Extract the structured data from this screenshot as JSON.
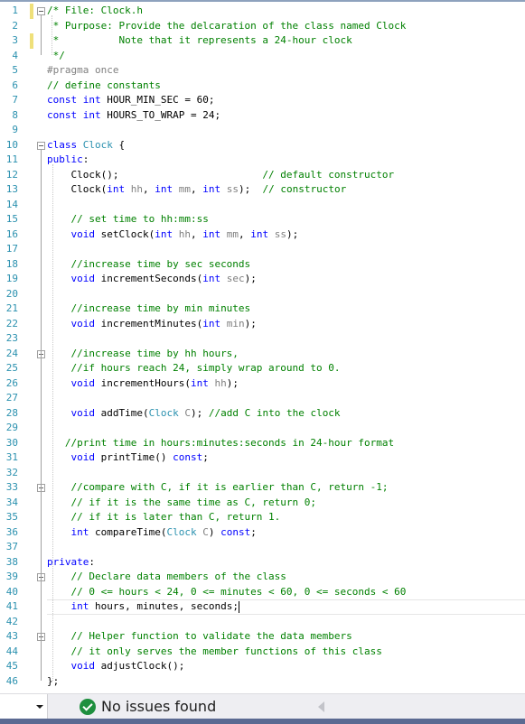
{
  "editor": {
    "file_name": "Clock.h",
    "lines": [
      {
        "n": "1",
        "text": "/* File: Clock.h"
      },
      {
        "n": "2",
        "text": " * Purpose: Provide the delcaration of the class named Clock"
      },
      {
        "n": "3",
        "text": " *          Note that it represents a 24-hour clock"
      },
      {
        "n": "4",
        "text": " */"
      },
      {
        "n": "5",
        "text": "#pragma once"
      },
      {
        "n": "6",
        "text": "// define constants"
      },
      {
        "n": "7",
        "text": "const int HOUR_MIN_SEC = 60;"
      },
      {
        "n": "8",
        "text": "const int HOURS_TO_WRAP = 24;"
      },
      {
        "n": "9",
        "text": ""
      },
      {
        "n": "10",
        "text": "class Clock {"
      },
      {
        "n": "11",
        "text": "public:"
      },
      {
        "n": "12",
        "text": "    Clock();                        // default constructor"
      },
      {
        "n": "13",
        "text": "    Clock(int hh, int mm, int ss);  // constructor"
      },
      {
        "n": "14",
        "text": ""
      },
      {
        "n": "15",
        "text": "    // set time to hh:mm:ss"
      },
      {
        "n": "16",
        "text": "    void setClock(int hh, int mm, int ss);"
      },
      {
        "n": "17",
        "text": ""
      },
      {
        "n": "18",
        "text": "    //increase time by sec seconds"
      },
      {
        "n": "19",
        "text": "    void incrementSeconds(int sec);"
      },
      {
        "n": "20",
        "text": ""
      },
      {
        "n": "21",
        "text": "    //increase time by min minutes"
      },
      {
        "n": "22",
        "text": "    void incrementMinutes(int min);"
      },
      {
        "n": "23",
        "text": ""
      },
      {
        "n": "24",
        "text": "    //increase time by hh hours,"
      },
      {
        "n": "25",
        "text": "    //if hours reach 24, simply wrap around to 0."
      },
      {
        "n": "26",
        "text": "    void incrementHours(int hh);"
      },
      {
        "n": "27",
        "text": ""
      },
      {
        "n": "28",
        "text": "    void addTime(Clock C); //add C into the clock"
      },
      {
        "n": "29",
        "text": ""
      },
      {
        "n": "30",
        "text": "   //print time in hours:minutes:seconds in 24-hour format"
      },
      {
        "n": "31",
        "text": "    void printTime() const;"
      },
      {
        "n": "32",
        "text": ""
      },
      {
        "n": "33",
        "text": "    //compare with C, if it is earlier than C, return -1;"
      },
      {
        "n": "34",
        "text": "    // if it is the same time as C, return 0;"
      },
      {
        "n": "35",
        "text": "    // if it is later than C, return 1."
      },
      {
        "n": "36",
        "text": "    int compareTime(Clock C) const;"
      },
      {
        "n": "37",
        "text": ""
      },
      {
        "n": "38",
        "text": "private:"
      },
      {
        "n": "39",
        "text": "    // Declare data members of the class"
      },
      {
        "n": "40",
        "text": "    // 0 <= hours < 24, 0 <= minutes < 60, 0 <= seconds < 60"
      },
      {
        "n": "41",
        "text": "    int hours, minutes, seconds;"
      },
      {
        "n": "42",
        "text": ""
      },
      {
        "n": "43",
        "text": "    // Helper function to validate the data members"
      },
      {
        "n": "44",
        "text": "    // it only serves the member functions of this class"
      },
      {
        "n": "45",
        "text": "    void adjustClock();"
      },
      {
        "n": "46",
        "text": "};"
      }
    ],
    "current_line": "41",
    "changed_lines": [
      "1",
      "3"
    ],
    "fold_lines": [
      "1",
      "10",
      "24",
      "33",
      "39",
      "43"
    ]
  },
  "status_bar": {
    "issues_text": "No issues found",
    "issues_icon": "check-circle-icon",
    "zoom_dropdown_icon": "chevron-down-icon"
  },
  "colors": {
    "comment": "#008000",
    "keyword": "#0000ff",
    "type": "#2b91af",
    "line_number": "#2b91af",
    "ok_green": "#1e8f3e",
    "change_marker": "#efe07a"
  }
}
